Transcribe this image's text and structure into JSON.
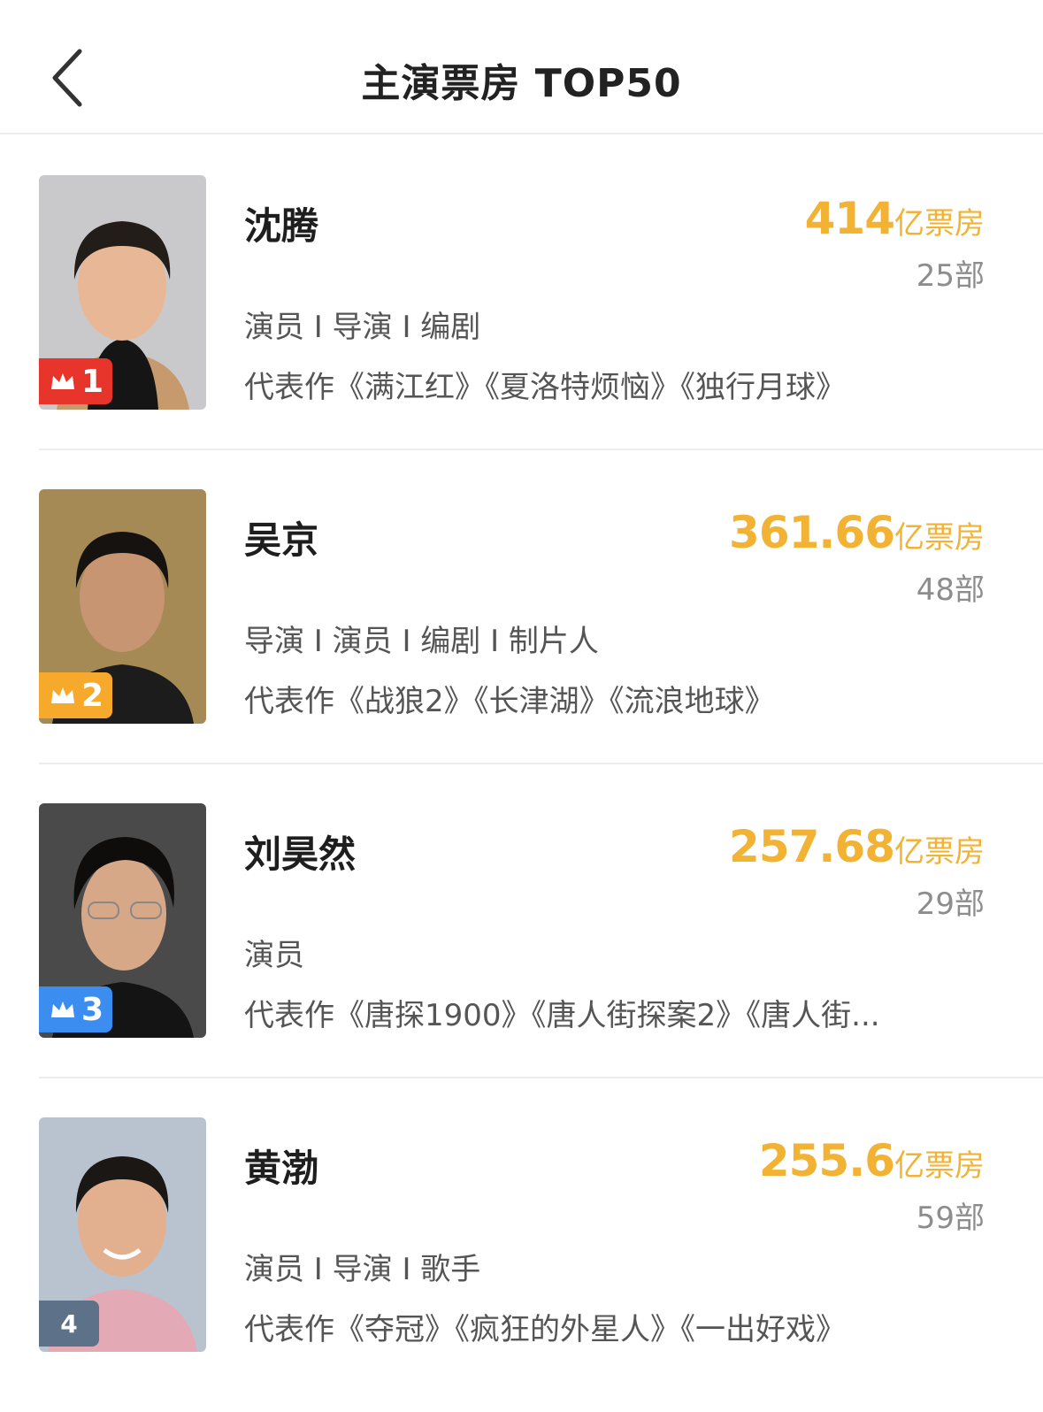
{
  "header": {
    "title": "主演票房 TOP50",
    "back_icon": "chevron-left-icon"
  },
  "colors": {
    "boxoffice": "#f2b233",
    "rank1": "#e8352c",
    "rank2": "#f7a92b",
    "rank3": "#3b8ef0",
    "rank_other": "#5d7189"
  },
  "actors": [
    {
      "rank": "1",
      "name": "沈腾",
      "boxoffice_value": "414",
      "boxoffice_unit": "亿票房",
      "film_count": "25部",
      "roles": "演员 I 导演 I 编剧",
      "works": "代表作《满江红》《夏洛特烦恼》《独行月球》"
    },
    {
      "rank": "2",
      "name": "吴京",
      "boxoffice_value": "361.66",
      "boxoffice_unit": "亿票房",
      "film_count": "48部",
      "roles": "导演 I 演员 I 编剧 I 制片人",
      "works": "代表作《战狼2》《长津湖》《流浪地球》"
    },
    {
      "rank": "3",
      "name": "刘昊然",
      "boxoffice_value": "257.68",
      "boxoffice_unit": "亿票房",
      "film_count": "29部",
      "roles": "演员",
      "works": "代表作《唐探1900》《唐人街探案2》《唐人街..."
    },
    {
      "rank": "4",
      "name": "黄渤",
      "boxoffice_value": "255.6",
      "boxoffice_unit": "亿票房",
      "film_count": "59部",
      "roles": "演员 I 导演 I 歌手",
      "works": "代表作《夺冠》《疯狂的外星人》《一出好戏》"
    }
  ]
}
